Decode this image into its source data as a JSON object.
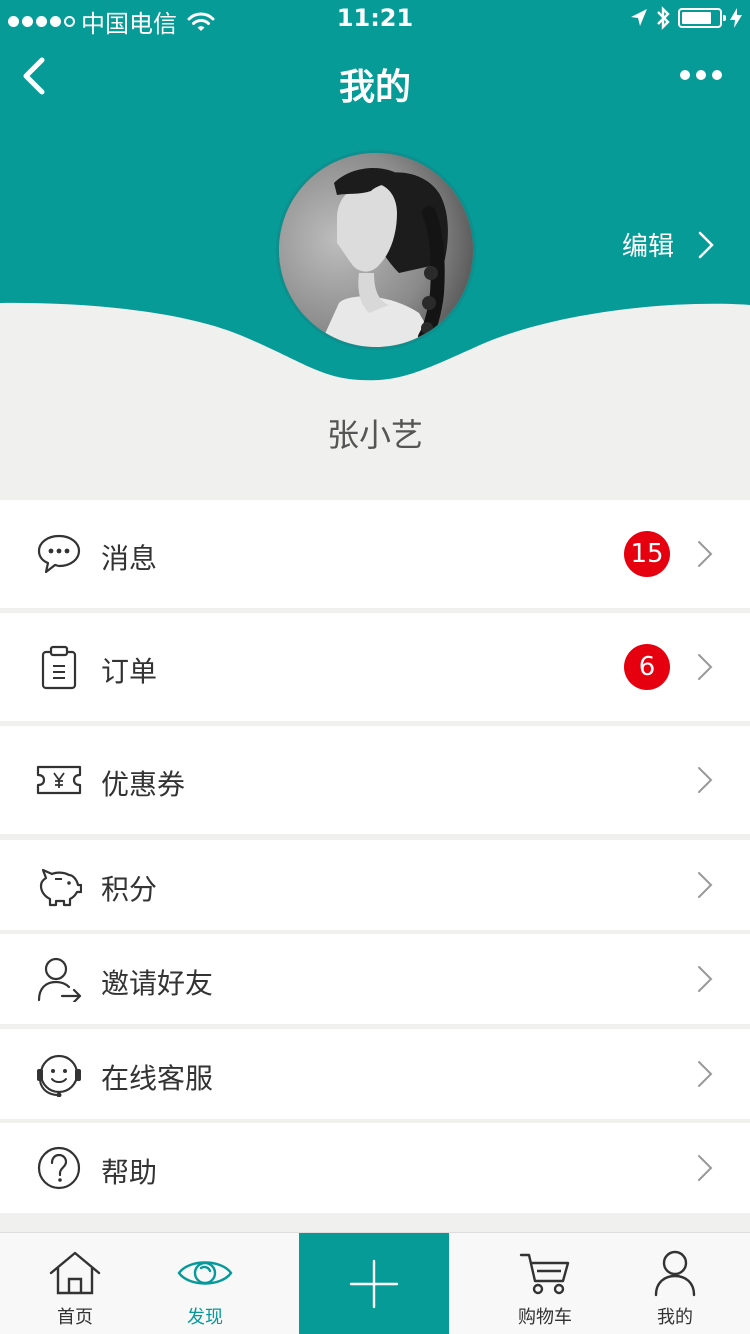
{
  "status_bar": {
    "carrier": "中国电信",
    "time": "11:21",
    "battery_level": 0.8
  },
  "nav": {
    "title": "我的",
    "back_icon": "back-chevron-icon",
    "more_icon": "more-dots-icon"
  },
  "profile": {
    "name": "张小艺",
    "edit_label": "编辑"
  },
  "menu": [
    {
      "label": "消息",
      "icon": "message-bubble-icon",
      "badge": "15"
    },
    {
      "label": "订单",
      "icon": "clipboard-icon",
      "badge": "6"
    },
    {
      "label": "优惠券",
      "icon": "coupon-ticket-icon",
      "badge": ""
    },
    {
      "label": "积分",
      "icon": "piggy-bank-icon",
      "badge": ""
    },
    {
      "label": "邀请好友",
      "icon": "invite-user-icon",
      "badge": ""
    },
    {
      "label": "在线客服",
      "icon": "headset-service-icon",
      "badge": ""
    },
    {
      "label": "帮助",
      "icon": "help-question-icon",
      "badge": ""
    }
  ],
  "tabbar": [
    {
      "label": "首页",
      "icon": "home-icon",
      "active": false
    },
    {
      "label": "发现",
      "icon": "eye-icon",
      "active": true
    },
    {
      "label": "",
      "icon": "plus-icon",
      "active": false
    },
    {
      "label": "购物车",
      "icon": "cart-icon",
      "active": false
    },
    {
      "label": "我的",
      "icon": "user-icon",
      "active": false
    }
  ],
  "colors": {
    "primary": "#079b98",
    "badge": "#e6000f",
    "background": "#f0f0ee"
  }
}
